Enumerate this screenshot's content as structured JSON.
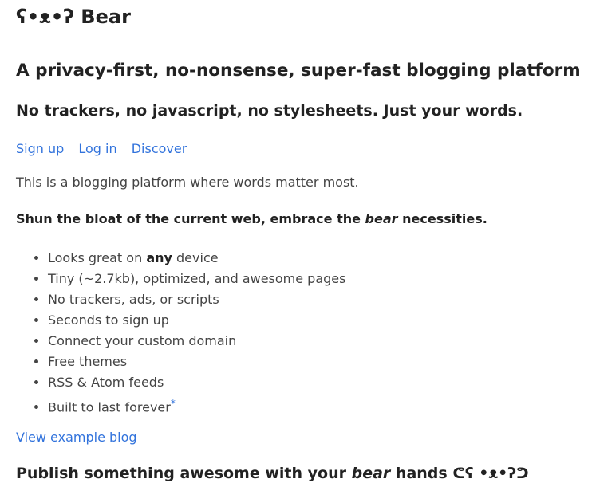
{
  "site": {
    "logo_glyph": "ʕ•ᴥ•ʔ",
    "name": "Bear"
  },
  "hero": {
    "headline": "A privacy-first, no-nonsense, super-fast blogging platform",
    "subheadline": "No trackers, no javascript, no stylesheets. Just your words."
  },
  "nav": {
    "signup": "Sign up",
    "login": "Log in",
    "discover": "Discover"
  },
  "intro": "This is a blogging platform where words matter most.",
  "tagline": {
    "before": "Shun the bloat of the current web, embrace the ",
    "emphasis": "bear",
    "after": " necessities."
  },
  "features": {
    "looks_before": "Looks great on ",
    "looks_bold": "any",
    "looks_after": " device",
    "items": [
      "Tiny (~2.7kb), optimized, and awesome pages",
      "No trackers, ads, or scripts",
      "Seconds to sign up",
      "Connect your custom domain",
      "Free themes",
      "RSS & Atom feeds"
    ],
    "last": "Built to last forever",
    "footnote_marker": "*"
  },
  "example_link": "View example blog",
  "cta": {
    "before": "Publish something awesome with your ",
    "emphasis": "bear",
    "after": " hands ",
    "emoticon": "ᕦʕ •ᴥ•ʔᕤ"
  },
  "colors": {
    "link": "#3273dc",
    "heading": "#222222",
    "text": "#444444",
    "background": "#ffffff"
  }
}
